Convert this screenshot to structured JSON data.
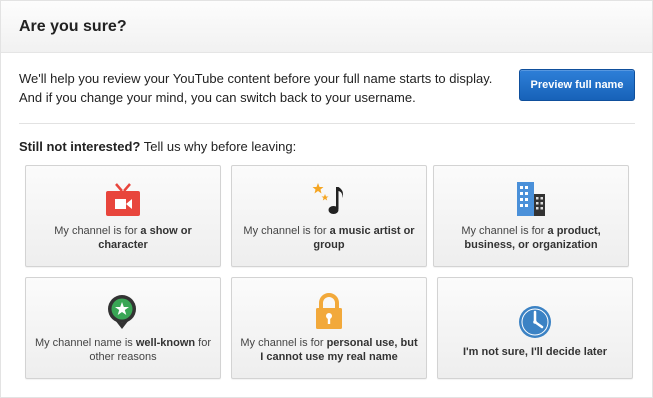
{
  "dialog": {
    "title": "Are you sure?",
    "intro_line1": "We'll help you review your YouTube content before your full name starts to display.",
    "intro_line2": "And if you change your mind, you can switch back to your username.",
    "preview_button": "Preview full name",
    "question_bold": "Still not interested?",
    "question_rest": " Tell us why before leaving:"
  },
  "options": [
    {
      "prefix": "My channel is for ",
      "bold": "a show or character",
      "suffix": "",
      "icon": "tv-icon"
    },
    {
      "prefix": "My channel is for ",
      "bold": "a music artist or group",
      "suffix": "",
      "icon": "music-note-icon"
    },
    {
      "prefix": "My channel is for ",
      "bold": "a product, business, or organization",
      "suffix": "",
      "icon": "buildings-icon"
    },
    {
      "prefix": "My channel name is ",
      "bold": "well-known",
      "suffix": " for other reasons",
      "icon": "star-badge-icon"
    },
    {
      "prefix": "My channel is for ",
      "bold": "personal use, but I cannot use my real name",
      "suffix": "",
      "icon": "padlock-icon"
    },
    {
      "prefix": "",
      "bold": "I'm not sure, I'll decide later",
      "suffix": "",
      "icon": "clock-icon"
    }
  ],
  "colors": {
    "button_blue": "#1762b8",
    "tv_red": "#e8453c",
    "music_gold": "#f5a623",
    "building_blue": "#4a90d9",
    "badge_green": "#3aa655",
    "lock_orange": "#f2a93b",
    "clock_blue": "#3b82c4"
  }
}
